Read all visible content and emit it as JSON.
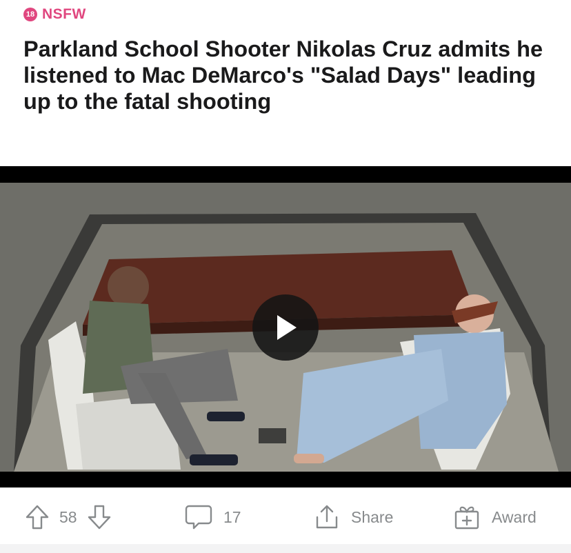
{
  "post": {
    "nsfw_badge": "18",
    "nsfw_label": "NSFW",
    "title": "Parkland School Shooter Nikolas Cruz admits he listened to Mac DeMarco's \"Salad Days\" leading up to the fatal shooting"
  },
  "media": {
    "type": "video",
    "play_icon": "play-icon"
  },
  "actions": {
    "upvote_icon": "arrow-up-icon",
    "score": "58",
    "downvote_icon": "arrow-down-icon",
    "comments_icon": "speech-bubble-icon",
    "comments_count": "17",
    "share_icon": "share-icon",
    "share_label": "Share",
    "award_icon": "gift-icon",
    "award_label": "Award"
  },
  "colors": {
    "nsfw": "#e0477f",
    "title": "#1a1a1b",
    "action_gray": "#878a8c"
  }
}
